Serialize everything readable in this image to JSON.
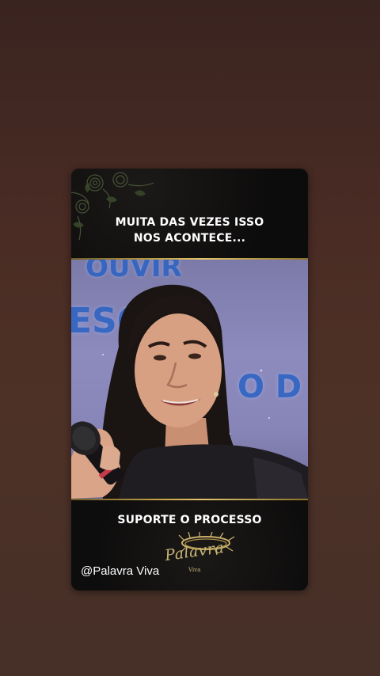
{
  "story": {
    "top_caption_line1": "MUITA DAS VEZES ISSO",
    "top_caption_line2": "NOS ACONTECE...",
    "bottom_caption": "SUPORTE O PROCESSO",
    "handle": "@Palavra Viva",
    "logo_title": "Palavra",
    "logo_subtitle": "Viva",
    "video_bg_text": [
      "OUVIR",
      "ESCUTA",
      "O D"
    ]
  },
  "colors": {
    "page_background": "#4a2c24",
    "card_background": "#111010",
    "gold_accent": "#c9a84a",
    "caption_text": "#ffffff",
    "stage_text": "#2b63c4"
  },
  "icons": [
    "roses-decoration-icon",
    "crown-of-thorns-icon",
    "microphone-icon"
  ]
}
